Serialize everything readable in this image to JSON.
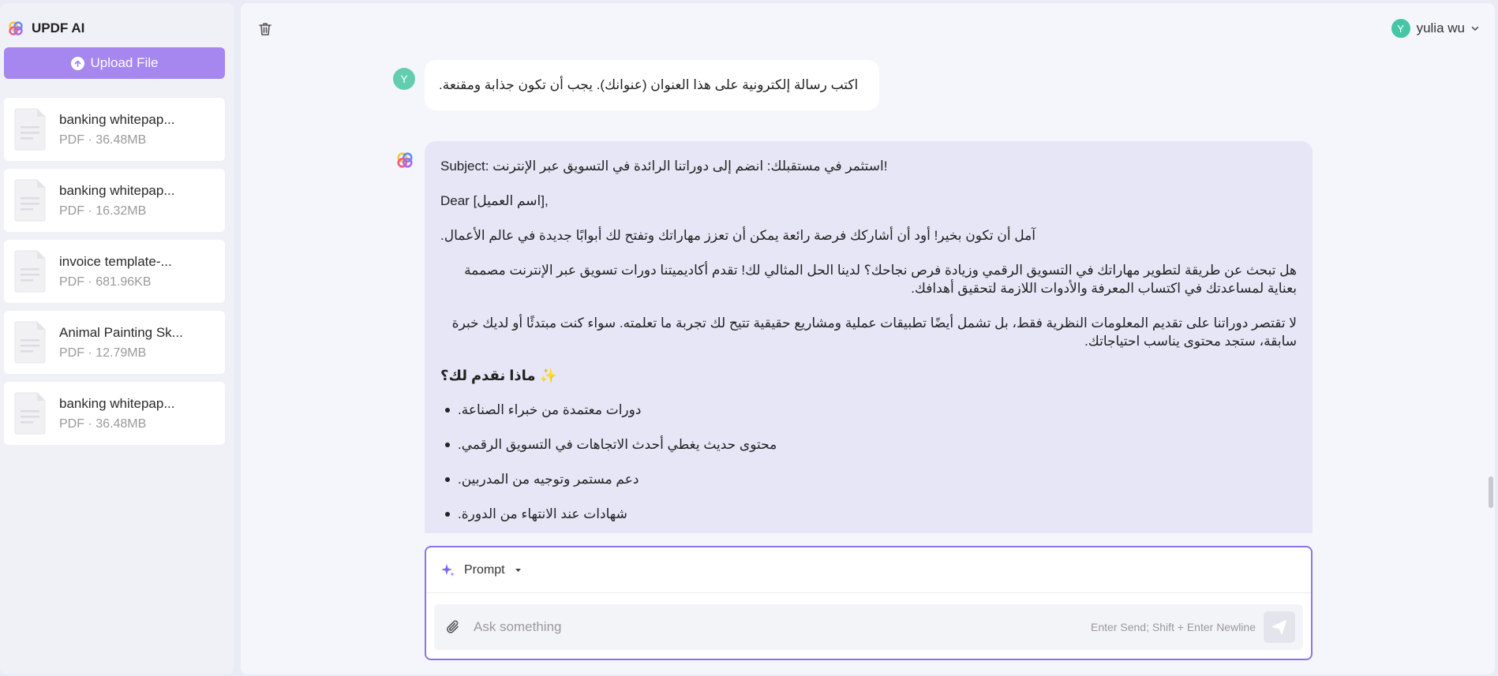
{
  "app": {
    "title": "UPDF AI"
  },
  "sidebar": {
    "upload_label": "Upload File",
    "files": [
      {
        "name": "banking whitepap...",
        "meta": "PDF · 36.48MB"
      },
      {
        "name": "banking whitepap...",
        "meta": "PDF · 16.32MB"
      },
      {
        "name": "invoice template-...",
        "meta": "PDF · 681.96KB"
      },
      {
        "name": "Animal Painting Sk...",
        "meta": "PDF · 12.79MB"
      },
      {
        "name": "banking whitepap...",
        "meta": "PDF · 36.48MB"
      }
    ]
  },
  "header": {
    "user_initial": "Y",
    "user_name": "yulia wu"
  },
  "conversation": {
    "user_initial": "Y",
    "user_message": "اكتب رسالة إلكترونية على هذا العنوان (عنوانك). يجب أن تكون جذابة ومقنعة.",
    "ai": {
      "subject": "Subject: استثمر في مستقبلك: انضم إلى دوراتنا الرائدة في التسويق عبر الإنترنت!",
      "greeting": "Dear [اسم العميل],",
      "p1": "آمل أن تكون بخير! أود أن أشاركك فرصة رائعة يمكن أن تعزز مهاراتك وتفتح لك أبوابًا جديدة في عالم الأعمال.",
      "p2": "هل تبحث عن طريقة لتطوير مهاراتك في التسويق الرقمي وزيادة فرص نجاحك؟ لدينا الحل المثالي لك! تقدم أكاديميتنا دورات تسويق عبر الإنترنت مصممة بعناية لمساعدتك في اكتساب المعرفة والأدوات اللازمة لتحقيق أهدافك.",
      "p3": "لا تقتصر دوراتنا على تقديم المعلومات النظرية فقط، بل تشمل أيضًا تطبيقات عملية ومشاريع حقيقية تتيح لك تجربة ما تعلمته. سواء كنت مبتدئًا أو لديك خبرة سابقة، ستجد محتوى يناسب احتياجاتك.",
      "heading": "✨ ماذا نقدم لك؟",
      "items": [
        "دورات معتمدة من خبراء الصناعة.",
        "محتوى حديث يغطي أحدث الاتجاهات في التسويق الرقمي.",
        "دعم مستمر وتوجيه من المدربين.",
        "شهادات عند الانتهاء من الدورة."
      ]
    }
  },
  "composer": {
    "prompt_label": "Prompt",
    "placeholder": "Ask something",
    "hint": "Enter Send; Shift + Enter Newline"
  }
}
